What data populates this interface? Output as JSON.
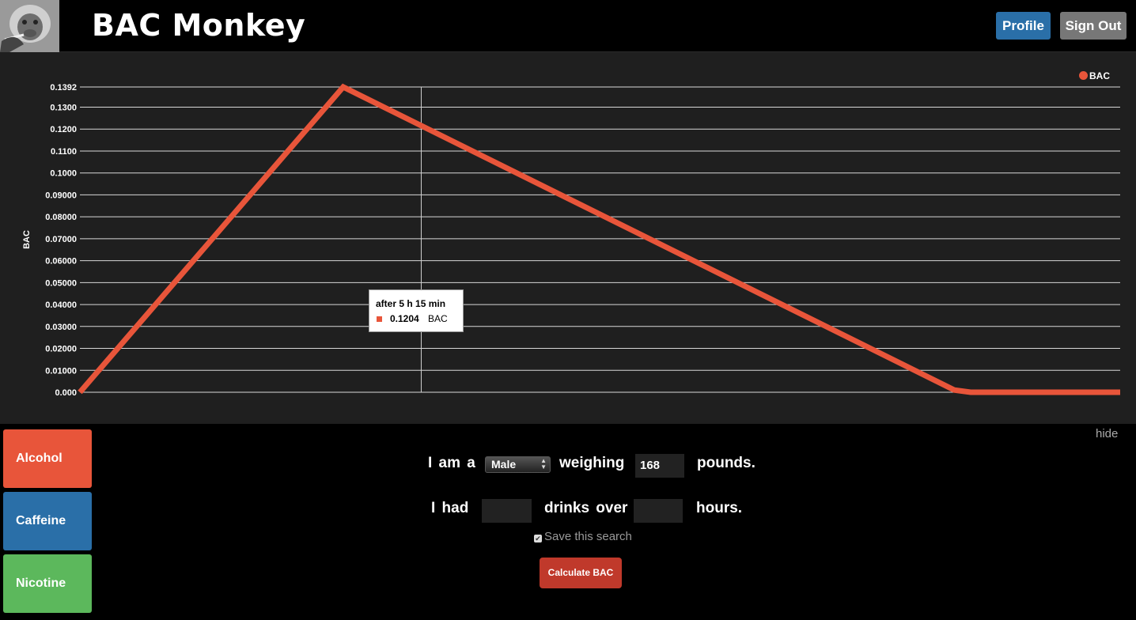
{
  "header": {
    "title": "BAC Monkey",
    "profile_label": "Profile",
    "signout_label": "Sign Out"
  },
  "chart_data": {
    "type": "line",
    "ylabel": "BAC",
    "y_ticks": [
      "0.000",
      "0.01000",
      "0.02000",
      "0.03000",
      "0.04000",
      "0.05000",
      "0.06000",
      "0.07000",
      "0.08000",
      "0.09000",
      "0.1000",
      "0.1100",
      "0.1200",
      "0.1300",
      "0.1392"
    ],
    "ylim": [
      0,
      0.1392
    ],
    "grid": true,
    "legend_position": "top-right",
    "series": [
      {
        "name": "BAC",
        "color": "#e8553a",
        "points": [
          {
            "x_hours": 0,
            "y": 0.0
          },
          {
            "x_hours": 4.05,
            "y": 0.1392
          },
          {
            "x_hours": 13.45,
            "y": 0.001
          },
          {
            "x_hours": 13.7,
            "y": 0.0
          },
          {
            "x_hours": 16.0,
            "y": 0.0
          }
        ]
      }
    ],
    "hover_x_hours": 5.25,
    "tooltip": {
      "title": "after 5 h 15 min",
      "value": "0.1204",
      "series": "BAC"
    }
  },
  "sidebar": {
    "tabs": [
      {
        "label": "Alcohol",
        "color": "#e8553a"
      },
      {
        "label": "Caffeine",
        "color": "#2a6fa8"
      },
      {
        "label": "Nicotine",
        "color": "#5cb85c"
      }
    ]
  },
  "hide_label": "hide",
  "form": {
    "i_am_a": "I am a",
    "gender_value": "Male",
    "weighing": "weighing",
    "weight_value": "168",
    "pounds": "pounds.",
    "i_had": "I had",
    "drinks_value": "",
    "drinks_over": "drinks over",
    "hours_value": "",
    "hours": "hours.",
    "save_label": "Save this search",
    "save_checked": true,
    "calculate_label": "Calculate BAC"
  }
}
